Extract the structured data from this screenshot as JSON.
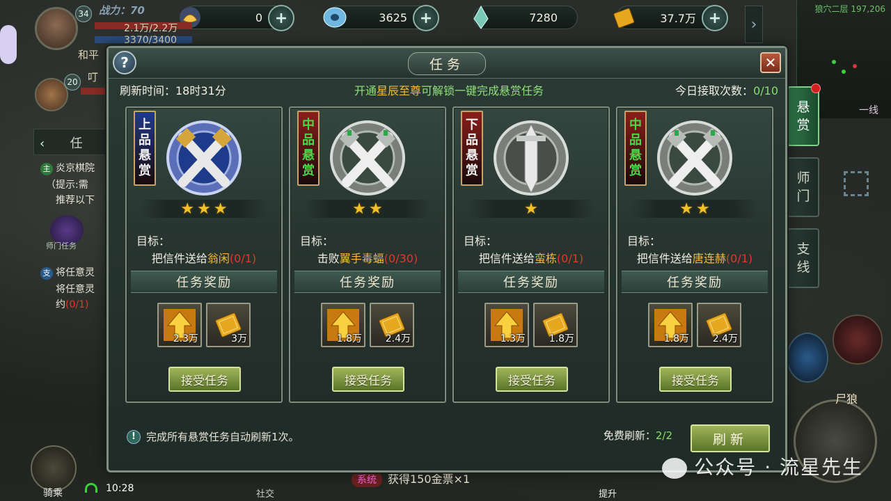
{
  "topbar": {
    "resources": [
      {
        "icon": "gold-ingot-icon",
        "value": "0",
        "color": "#f2c64a"
      },
      {
        "icon": "silver-coin-icon",
        "value": "3625",
        "color": "#9fd6f2"
      },
      {
        "icon": "crystal-icon",
        "value": "7280",
        "color": "#7ac9b6"
      },
      {
        "icon": "gold-ticket-icon",
        "value": "37.7万",
        "color": "#f4c02a"
      }
    ]
  },
  "player": {
    "power_label": "战力：70",
    "level": "34",
    "hp": "2.1万/2.2万",
    "mp": "3370/3400",
    "mode": "和平",
    "pet_level": "20",
    "pet_name": "叮"
  },
  "minimap": {
    "location": "狼穴二层 197,206",
    "line": "一线"
  },
  "tracker": {
    "header": "任",
    "main_tag": "主",
    "main_title": "炎京棋院",
    "main_hint": "（提示:需",
    "main_more": "推荐以下",
    "icon_caption": "师门任务",
    "branch_tag": "支",
    "branch_title": "将任意灵",
    "branch_desc": "将任意灵",
    "branch_more_a": "约",
    "branch_more_b": "(0/1)"
  },
  "dialog": {
    "title": "任务",
    "help": "?",
    "close": "✕",
    "refresh_time": "刷新时间：18时31分",
    "promo_a": "开通",
    "promo_hl": "星辰至尊",
    "promo_b": "可解锁一键完成悬赏任务",
    "daily_a": "今日接取次数：",
    "daily_cnt": "0/10",
    "goal_label": "目标：",
    "reward_label": "任务奖励",
    "accept_label": "接受任务",
    "footer_tip": "完成所有悬赏任务自动刷新1次。",
    "free_refresh_a": "免费刷新：",
    "free_refresh_cnt": "2/2",
    "refresh_btn": "刷新",
    "cards": [
      {
        "grade": [
          "上",
          "品",
          "悬",
          "赏"
        ],
        "grade_color": "#f0f0f0",
        "ribbon": "#1f3a8a",
        "stars": 3,
        "goal_a": "把信件送给",
        "target": "翁闲",
        "progress": "(0/1)",
        "reward1": "2.3万",
        "reward2": "3万",
        "emblem": "sapphire-crossed-fists-emblem-icon"
      },
      {
        "grade": [
          "中",
          "品",
          "悬",
          "赏"
        ],
        "grade_color": "#4ad84a",
        "ribbon": "#8b1e1a",
        "stars": 2,
        "goal_a": "击败",
        "target": "翼手毒蝠",
        "progress": "(0/30)",
        "reward1": "1.8万",
        "reward2": "2.4万",
        "emblem": "silver-crossed-fists-emblem-icon"
      },
      {
        "grade": [
          "下",
          "品",
          "悬",
          "赏"
        ],
        "grade_color": "#f0f0f0",
        "ribbon": "#8b1e1a",
        "stars": 1,
        "goal_a": "把信件送给",
        "target": "蛮栋",
        "progress": "(0/1)",
        "reward1": "1.3万",
        "reward2": "1.8万",
        "emblem": "silver-sword-emblem-icon"
      },
      {
        "grade": [
          "中",
          "品",
          "悬",
          "赏"
        ],
        "grade_color": "#4ad84a",
        "ribbon": "#8b1e1a",
        "stars": 2,
        "goal_a": "把信件送给",
        "target": "唐连赫",
        "progress": "(0/1)",
        "reward1": "1.8万",
        "reward2": "2.4万",
        "emblem": "silver-crossed-fists-emblem-icon"
      }
    ]
  },
  "tabs": [
    {
      "label": [
        "悬",
        "赏"
      ],
      "active": true
    },
    {
      "label": [
        "师",
        "门"
      ],
      "active": false
    },
    {
      "label": [
        "支",
        "线"
      ],
      "active": false
    }
  ],
  "bottom": {
    "mount": "骑乘",
    "time": "10:28",
    "system_chip": "系统",
    "system_msg": "获得150金票×1",
    "social": "社交",
    "upgrade": "提升",
    "enemy": "尸狼"
  },
  "watermark": "公众号 · 流星先生"
}
